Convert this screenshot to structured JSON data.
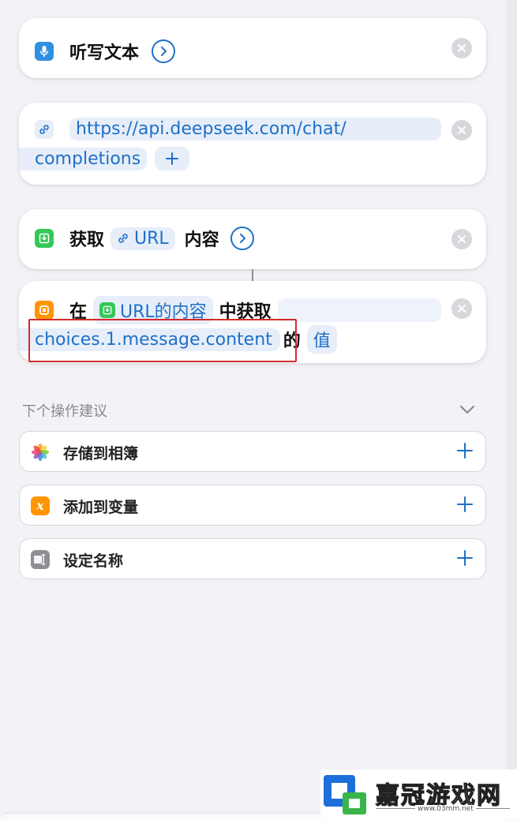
{
  "cards": {
    "dictate": {
      "label": "听写文本"
    },
    "url": {
      "line1": "https://api.deepseek.com/chat/",
      "line2": "completions"
    },
    "get": {
      "label": "获取",
      "token": "URL",
      "suffix": "内容"
    },
    "dict": {
      "prefix": "在",
      "token": "URL的内容",
      "middle": "中获取",
      "key": "choices.1.message.content",
      "de": "的",
      "value": "值"
    }
  },
  "suggestions": {
    "title": "下个操作建议",
    "items": [
      {
        "label": "存储到相簿",
        "icon": "photos-icon"
      },
      {
        "label": "添加到变量",
        "icon": "variable-icon"
      },
      {
        "label": "设定名称",
        "icon": "text-icon"
      }
    ]
  },
  "watermark": {
    "brand": "嘉冠游戏网",
    "url": "www.03mm.net"
  },
  "colors": {
    "accent": "#1f70c8",
    "highlight_box": "#d32b2b",
    "dictate_icon": "#2f8fe0",
    "get_icon": "#34c759",
    "dict_icon": "#ff9500",
    "var_icon": "#ff9500",
    "text_icon": "#8e8e93"
  }
}
